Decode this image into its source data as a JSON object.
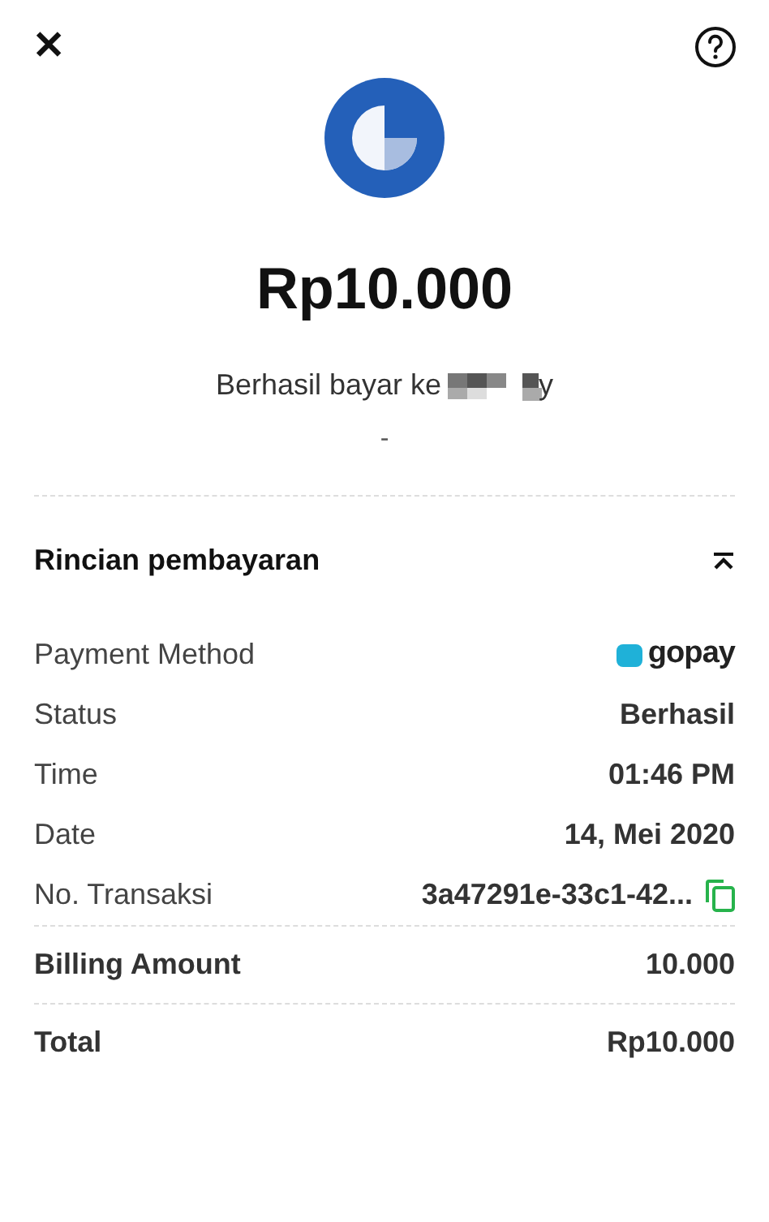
{
  "header": {
    "close": "✕"
  },
  "amount": "Rp10.000",
  "subtitle": {
    "text": "Berhasil bayar ke",
    "merchant_visible": "y"
  },
  "note": "-",
  "details": {
    "title": "Rincian pembayaran",
    "expanded": true,
    "rows": [
      {
        "kind": "logo",
        "label": "Payment Method",
        "value": "gopay"
      },
      {
        "kind": "text",
        "label": "Status",
        "value": "Berhasil"
      },
      {
        "kind": "text",
        "label": "Time",
        "value": "01:46 PM"
      },
      {
        "kind": "text",
        "label": "Date",
        "value": "14, Mei 2020"
      },
      {
        "kind": "copy",
        "label": "No. Transaksi",
        "value": "3a47291e-33c1-42..."
      }
    ]
  },
  "summary": [
    {
      "label": "Billing Amount",
      "value": "10.000"
    },
    {
      "label": "Total",
      "value": "Rp10.000"
    }
  ]
}
